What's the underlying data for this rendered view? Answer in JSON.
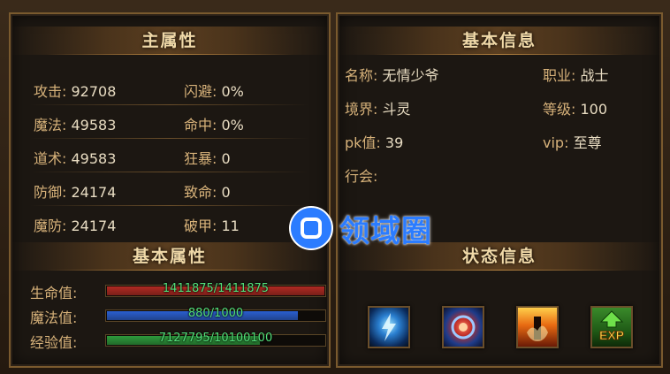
{
  "main_attrs": {
    "title": "主属性",
    "rows": [
      {
        "left_label": "攻击:",
        "left_value": "92708",
        "right_label": "闪避:",
        "right_value": "0%"
      },
      {
        "left_label": "魔法:",
        "left_value": "49583",
        "right_label": "命中:",
        "right_value": "0%"
      },
      {
        "left_label": "道术:",
        "left_value": "49583",
        "right_label": "狂暴:",
        "right_value": "0"
      },
      {
        "left_label": "防御:",
        "left_value": "24174",
        "right_label": "致命:",
        "right_value": "0"
      },
      {
        "left_label": "魔防:",
        "left_value": "24174",
        "right_label": "破甲:",
        "right_value": "11"
      }
    ]
  },
  "basic_attrs": {
    "title": "基本属性",
    "bars": [
      {
        "label": "生命值:",
        "text": "1411875/1411875",
        "fraction": 1.0,
        "color": "#b02a22"
      },
      {
        "label": "魔法值:",
        "text": "880/1000",
        "fraction": 0.88,
        "color": "#2a5fd0"
      },
      {
        "label": "经验值:",
        "text": "7127795/10100100",
        "fraction": 0.7057,
        "color": "#2d9a3c"
      }
    ]
  },
  "basic_info": {
    "title": "基本信息",
    "name_label": "名称:",
    "name_value": "无情少爷",
    "job_label": "职业:",
    "job_value": "战士",
    "realm_label": "境界:",
    "realm_value": "斗灵",
    "level_label": "等级:",
    "level_value": "100",
    "pk_label": "pk值:",
    "pk_value": "39",
    "vip_label": "vip:",
    "vip_value": "至尊",
    "guild_label": "行会:",
    "guild_value": ""
  },
  "status": {
    "title": "状态信息",
    "icons": [
      "lightning-shield-icon",
      "fire-orb-icon",
      "flame-warrior-icon",
      "exp-boost-icon"
    ]
  },
  "watermark": {
    "text": "领域圈"
  }
}
